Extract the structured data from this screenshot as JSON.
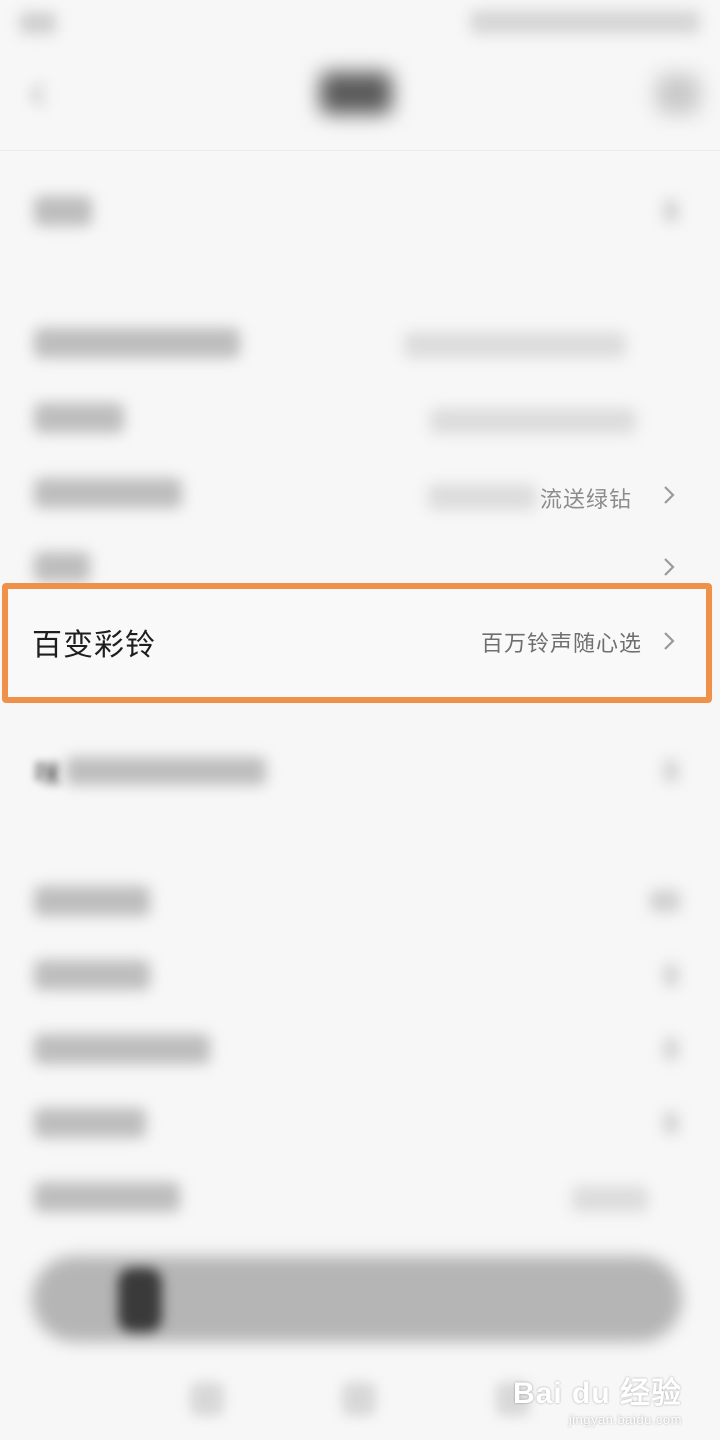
{
  "highlighted_item": {
    "label": "百变彩铃",
    "value": "百万铃声随心选"
  },
  "partial_row": {
    "value": "流送绿钻"
  },
  "migu_row": {
    "label_prefix": "咪"
  },
  "watermark": {
    "brand": "Bai du 经验",
    "url": "jingyan.baidu.com"
  },
  "colors": {
    "highlight_border": "#f0914a",
    "background": "#f7f7f7"
  },
  "icons": {
    "back": "back-arrow-icon",
    "chevron": "chevron-right-icon"
  }
}
